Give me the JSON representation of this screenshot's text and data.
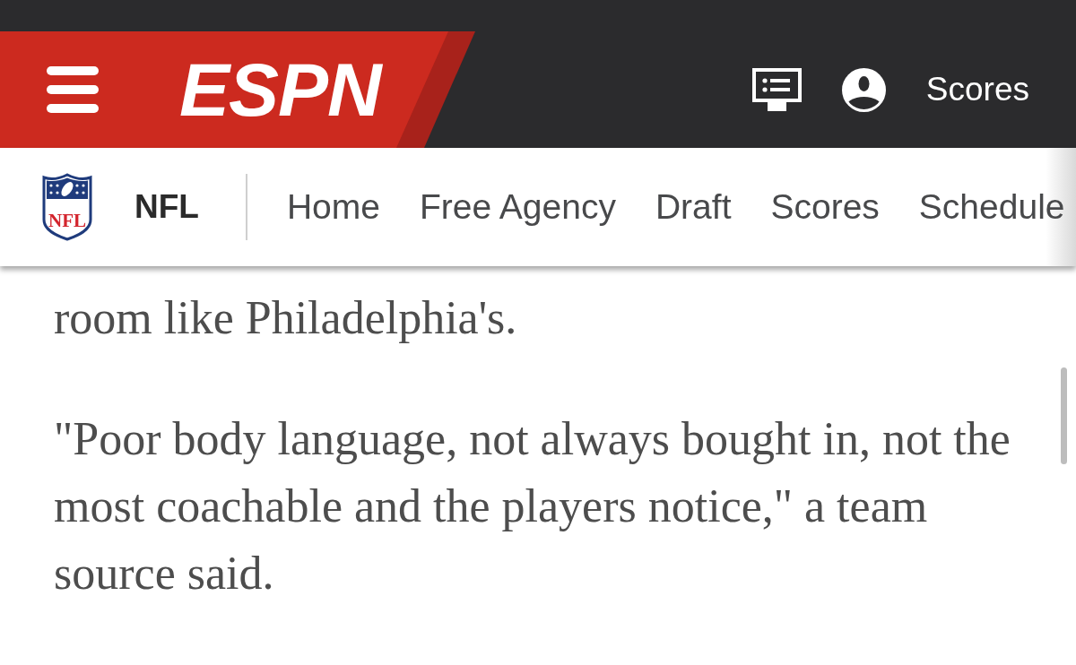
{
  "header": {
    "logo": "ESPN",
    "scores_link": "Scores"
  },
  "nav": {
    "shield_text": "NFL",
    "league": "NFL",
    "links": [
      "Home",
      "Free Agency",
      "Draft",
      "Scores",
      "Schedule"
    ]
  },
  "article": {
    "paragraphs": [
      "room like Philadelphia's.",
      "\"Poor body language, not always bought in, not the most coachable and the players notice,\" a team source said."
    ]
  }
}
